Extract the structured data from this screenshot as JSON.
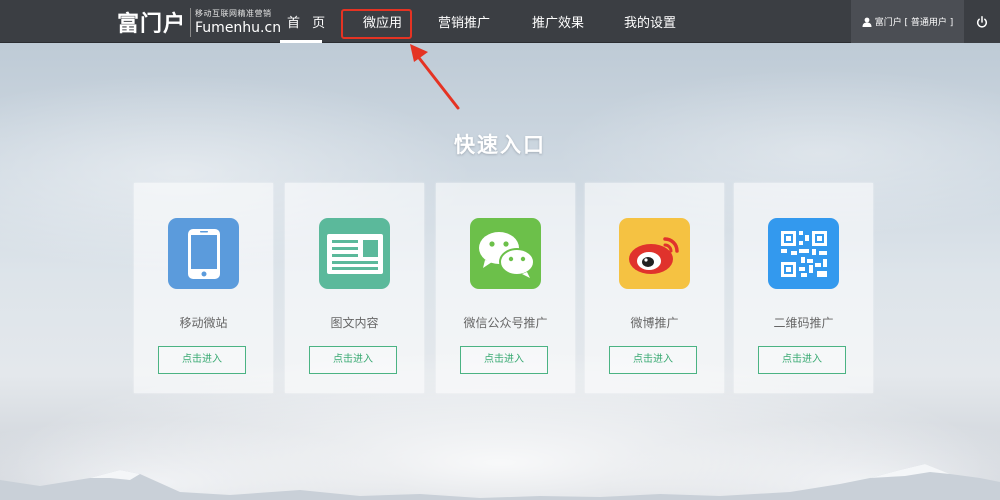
{
  "brand": {
    "logo_cn": "富门户",
    "tagline": "移动互联网精准营销",
    "logo_en": "Fumenhu.cn"
  },
  "nav": {
    "items": [
      {
        "label": "首 页",
        "active": true
      },
      {
        "label": "微应用",
        "highlighted": true
      },
      {
        "label": "营销推广"
      },
      {
        "label": "推广效果"
      },
      {
        "label": "我的设置"
      }
    ]
  },
  "user": {
    "icon": "user-icon",
    "text": "富门户 [ 普通用户 ]"
  },
  "power": {
    "icon": "power-icon"
  },
  "headline": "快速入口",
  "cards": [
    {
      "label": "移动微站",
      "button": "点击进入",
      "icon": "mobile-phone-icon",
      "color": "#5b9bdc"
    },
    {
      "label": "图文内容",
      "button": "点击进入",
      "icon": "article-icon",
      "color": "#5bb99b"
    },
    {
      "label": "微信公众号推广",
      "button": "点击进入",
      "icon": "wechat-icon",
      "color": "#6cc04a"
    },
    {
      "label": "微博推广",
      "button": "点击进入",
      "icon": "weibo-icon",
      "color": "#f5c242"
    },
    {
      "label": "二维码推广",
      "button": "点击进入",
      "icon": "qr-code-icon",
      "color": "#3399ee"
    }
  ],
  "colors": {
    "topbar": "#3b3e43",
    "accent_green": "#3aaa73",
    "annotation_red": "#e53323"
  }
}
